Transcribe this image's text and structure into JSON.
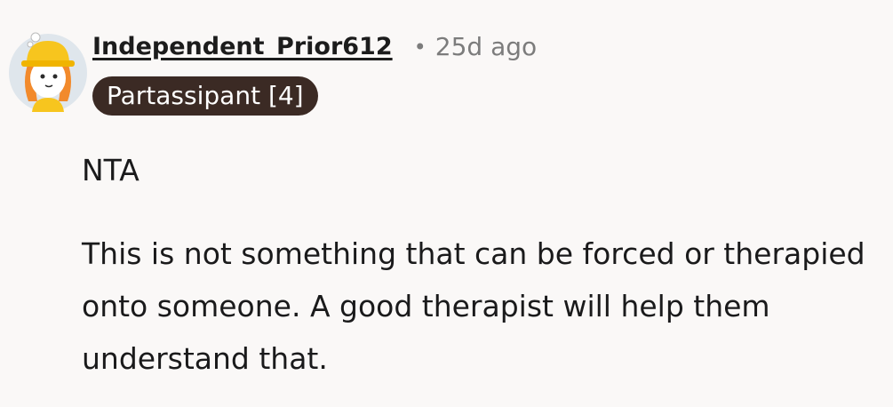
{
  "comment": {
    "author": "Independent_Prior612",
    "separator": "•",
    "timestamp": "25d ago",
    "flair": "Partassipant [4]",
    "body": {
      "verdict": "NTA",
      "paragraph": "This is not something that can be forced or therapied onto someone. A good therapist will help them understand that."
    }
  },
  "colors": {
    "background": "#faf8f7",
    "flair_background": "#3b2a24",
    "muted_text": "#7c7c7c"
  }
}
